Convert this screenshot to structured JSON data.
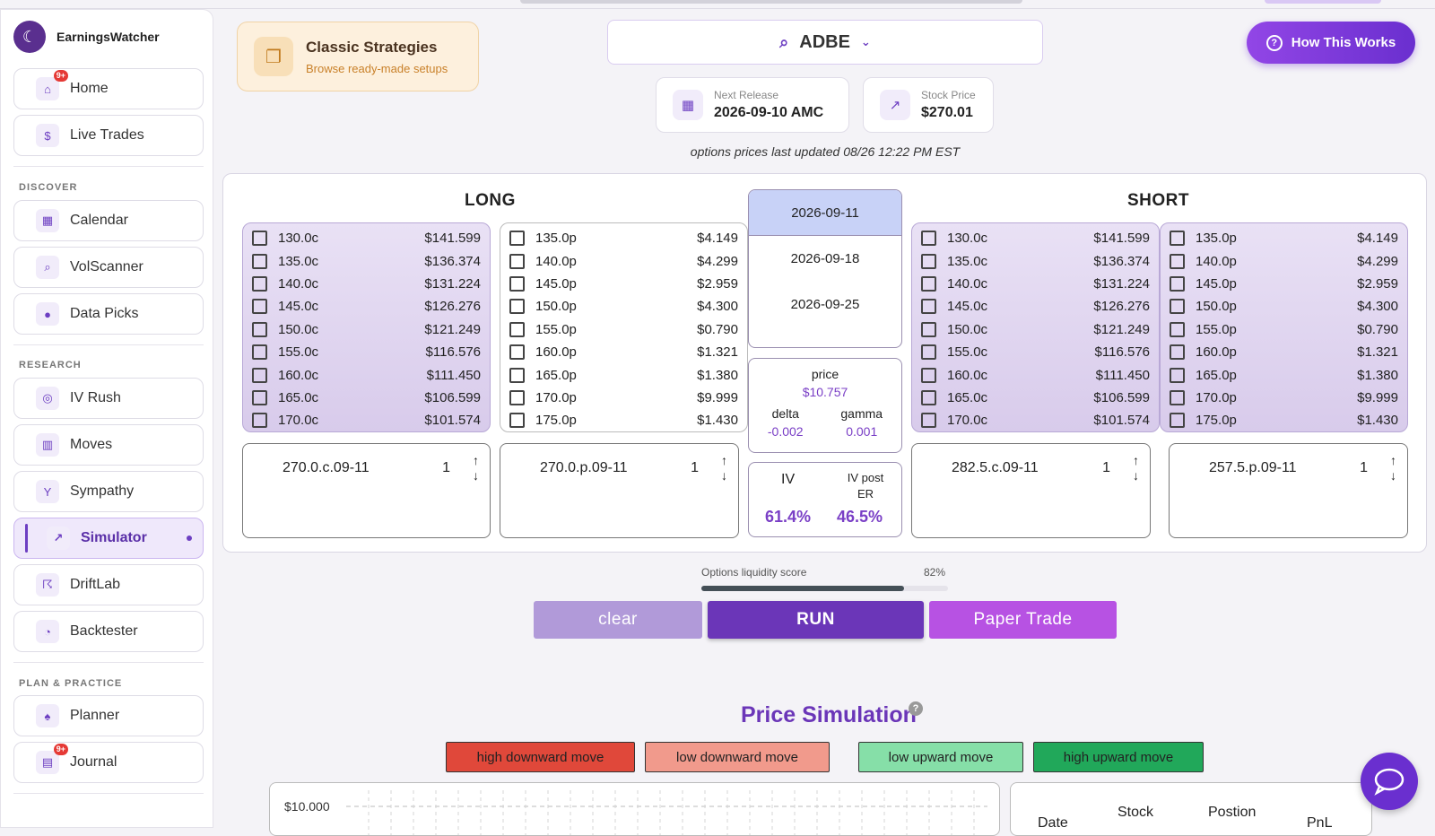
{
  "app": {
    "name": "EarningsWatcher"
  },
  "nav": {
    "home": {
      "label": "Home",
      "badge": "9+"
    },
    "live": {
      "label": "Live Trades"
    },
    "discover_title": "DISCOVER",
    "calendar": {
      "label": "Calendar"
    },
    "volscanner": {
      "label": "VolScanner"
    },
    "datapicks": {
      "label": "Data Picks"
    },
    "research_title": "RESEARCH",
    "ivrush": {
      "label": "IV Rush"
    },
    "moves": {
      "label": "Moves"
    },
    "sympathy": {
      "label": "Sympathy"
    },
    "simulator": {
      "label": "Simulator"
    },
    "driftlab": {
      "label": "DriftLab"
    },
    "backtester": {
      "label": "Backtester"
    },
    "plan_title": "PLAN & PRACTICE",
    "planner": {
      "label": "Planner"
    },
    "journal": {
      "label": "Journal",
      "badge": "9+"
    }
  },
  "classic": {
    "title": "Classic Strategies",
    "subtitle": "Browse ready-made setups"
  },
  "search": {
    "ticker": "ADBE"
  },
  "release": {
    "label": "Next Release",
    "value": "2026-09-10 AMC"
  },
  "stock": {
    "label": "Stock Price",
    "value": "$270.01"
  },
  "updated": "options prices last updated 08/26 12:22 PM EST",
  "how": {
    "label": "How This Works"
  },
  "long_title": "LONG",
  "short_title": "SHORT",
  "calls": [
    {
      "strike": "130.0c",
      "price": "$141.599"
    },
    {
      "strike": "135.0c",
      "price": "$136.374"
    },
    {
      "strike": "140.0c",
      "price": "$131.224"
    },
    {
      "strike": "145.0c",
      "price": "$126.276"
    },
    {
      "strike": "150.0c",
      "price": "$121.249"
    },
    {
      "strike": "155.0c",
      "price": "$116.576"
    },
    {
      "strike": "160.0c",
      "price": "$111.450"
    },
    {
      "strike": "165.0c",
      "price": "$106.599"
    },
    {
      "strike": "170.0c",
      "price": "$101.574"
    }
  ],
  "puts": [
    {
      "strike": "135.0p",
      "price": "$4.149"
    },
    {
      "strike": "140.0p",
      "price": "$4.299"
    },
    {
      "strike": "145.0p",
      "price": "$2.959"
    },
    {
      "strike": "150.0p",
      "price": "$4.300"
    },
    {
      "strike": "155.0p",
      "price": "$0.790"
    },
    {
      "strike": "160.0p",
      "price": "$1.321"
    },
    {
      "strike": "165.0p",
      "price": "$1.380"
    },
    {
      "strike": "170.0p",
      "price": "$9.999"
    },
    {
      "strike": "175.0p",
      "price": "$1.430"
    }
  ],
  "expiries": [
    "2026-09-11",
    "2026-09-18",
    "2026-09-25"
  ],
  "greeks": {
    "price_label": "price",
    "price": "$10.757",
    "delta_label": "delta",
    "delta": "-0.002",
    "gamma_label": "gamma",
    "gamma": "0.001"
  },
  "iv": {
    "iv_label": "IV",
    "iv": "61.4%",
    "post_label": "IV post ER",
    "post": "46.5%"
  },
  "legs": [
    {
      "name": "270.0.c.09-11",
      "qty": "1"
    },
    {
      "name": "270.0.p.09-11",
      "qty": "1"
    },
    {
      "name": "282.5.c.09-11",
      "qty": "1"
    },
    {
      "name": "257.5.p.09-11",
      "qty": "1"
    }
  ],
  "liquidity": {
    "label": "Options liquidity score",
    "value": "82%",
    "fraction": 0.82
  },
  "actions": {
    "clear": "clear",
    "run": "RUN",
    "paper": "Paper Trade"
  },
  "simulation": {
    "title": "Price Simulation",
    "help": "?"
  },
  "moves": {
    "high_down": "high downward move",
    "low_down": "low downward move",
    "low_up": "low upward move",
    "high_up": "high upward move"
  },
  "colors": {
    "high_down": "#e0483a",
    "low_down": "#f19a8c",
    "low_up": "#86dfa8",
    "high_up": "#21a85a",
    "accent": "#6b36b8"
  },
  "chart": {
    "ytick": "$10.000"
  },
  "table": {
    "date": "Date",
    "stock": "Stock",
    "position": "Postion",
    "pnl": "PnL"
  }
}
